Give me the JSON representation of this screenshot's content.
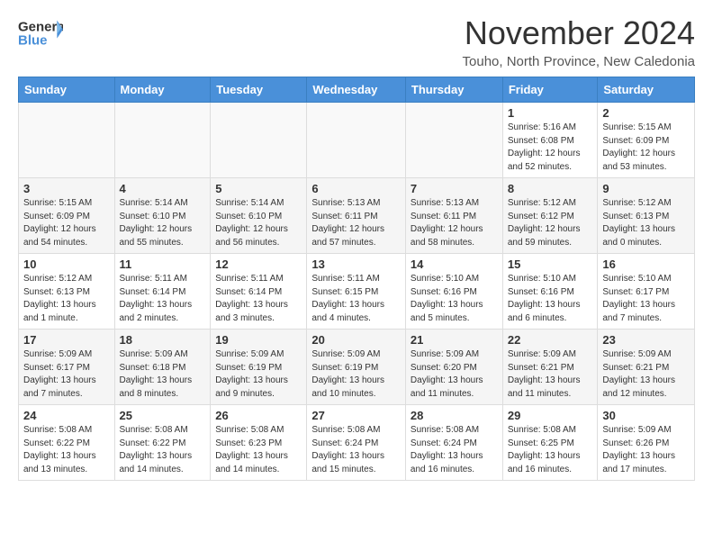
{
  "header": {
    "logo_general": "General",
    "logo_blue": "Blue",
    "month_title": "November 2024",
    "location": "Touho, North Province, New Caledonia"
  },
  "calendar": {
    "weekdays": [
      "Sunday",
      "Monday",
      "Tuesday",
      "Wednesday",
      "Thursday",
      "Friday",
      "Saturday"
    ],
    "weeks": [
      [
        {
          "day": "",
          "info": ""
        },
        {
          "day": "",
          "info": ""
        },
        {
          "day": "",
          "info": ""
        },
        {
          "day": "",
          "info": ""
        },
        {
          "day": "",
          "info": ""
        },
        {
          "day": "1",
          "info": "Sunrise: 5:16 AM\nSunset: 6:08 PM\nDaylight: 12 hours\nand 52 minutes."
        },
        {
          "day": "2",
          "info": "Sunrise: 5:15 AM\nSunset: 6:09 PM\nDaylight: 12 hours\nand 53 minutes."
        }
      ],
      [
        {
          "day": "3",
          "info": "Sunrise: 5:15 AM\nSunset: 6:09 PM\nDaylight: 12 hours\nand 54 minutes."
        },
        {
          "day": "4",
          "info": "Sunrise: 5:14 AM\nSunset: 6:10 PM\nDaylight: 12 hours\nand 55 minutes."
        },
        {
          "day": "5",
          "info": "Sunrise: 5:14 AM\nSunset: 6:10 PM\nDaylight: 12 hours\nand 56 minutes."
        },
        {
          "day": "6",
          "info": "Sunrise: 5:13 AM\nSunset: 6:11 PM\nDaylight: 12 hours\nand 57 minutes."
        },
        {
          "day": "7",
          "info": "Sunrise: 5:13 AM\nSunset: 6:11 PM\nDaylight: 12 hours\nand 58 minutes."
        },
        {
          "day": "8",
          "info": "Sunrise: 5:12 AM\nSunset: 6:12 PM\nDaylight: 12 hours\nand 59 minutes."
        },
        {
          "day": "9",
          "info": "Sunrise: 5:12 AM\nSunset: 6:13 PM\nDaylight: 13 hours\nand 0 minutes."
        }
      ],
      [
        {
          "day": "10",
          "info": "Sunrise: 5:12 AM\nSunset: 6:13 PM\nDaylight: 13 hours\nand 1 minute."
        },
        {
          "day": "11",
          "info": "Sunrise: 5:11 AM\nSunset: 6:14 PM\nDaylight: 13 hours\nand 2 minutes."
        },
        {
          "day": "12",
          "info": "Sunrise: 5:11 AM\nSunset: 6:14 PM\nDaylight: 13 hours\nand 3 minutes."
        },
        {
          "day": "13",
          "info": "Sunrise: 5:11 AM\nSunset: 6:15 PM\nDaylight: 13 hours\nand 4 minutes."
        },
        {
          "day": "14",
          "info": "Sunrise: 5:10 AM\nSunset: 6:16 PM\nDaylight: 13 hours\nand 5 minutes."
        },
        {
          "day": "15",
          "info": "Sunrise: 5:10 AM\nSunset: 6:16 PM\nDaylight: 13 hours\nand 6 minutes."
        },
        {
          "day": "16",
          "info": "Sunrise: 5:10 AM\nSunset: 6:17 PM\nDaylight: 13 hours\nand 7 minutes."
        }
      ],
      [
        {
          "day": "17",
          "info": "Sunrise: 5:09 AM\nSunset: 6:17 PM\nDaylight: 13 hours\nand 7 minutes."
        },
        {
          "day": "18",
          "info": "Sunrise: 5:09 AM\nSunset: 6:18 PM\nDaylight: 13 hours\nand 8 minutes."
        },
        {
          "day": "19",
          "info": "Sunrise: 5:09 AM\nSunset: 6:19 PM\nDaylight: 13 hours\nand 9 minutes."
        },
        {
          "day": "20",
          "info": "Sunrise: 5:09 AM\nSunset: 6:19 PM\nDaylight: 13 hours\nand 10 minutes."
        },
        {
          "day": "21",
          "info": "Sunrise: 5:09 AM\nSunset: 6:20 PM\nDaylight: 13 hours\nand 11 minutes."
        },
        {
          "day": "22",
          "info": "Sunrise: 5:09 AM\nSunset: 6:21 PM\nDaylight: 13 hours\nand 11 minutes."
        },
        {
          "day": "23",
          "info": "Sunrise: 5:09 AM\nSunset: 6:21 PM\nDaylight: 13 hours\nand 12 minutes."
        }
      ],
      [
        {
          "day": "24",
          "info": "Sunrise: 5:08 AM\nSunset: 6:22 PM\nDaylight: 13 hours\nand 13 minutes."
        },
        {
          "day": "25",
          "info": "Sunrise: 5:08 AM\nSunset: 6:22 PM\nDaylight: 13 hours\nand 14 minutes."
        },
        {
          "day": "26",
          "info": "Sunrise: 5:08 AM\nSunset: 6:23 PM\nDaylight: 13 hours\nand 14 minutes."
        },
        {
          "day": "27",
          "info": "Sunrise: 5:08 AM\nSunset: 6:24 PM\nDaylight: 13 hours\nand 15 minutes."
        },
        {
          "day": "28",
          "info": "Sunrise: 5:08 AM\nSunset: 6:24 PM\nDaylight: 13 hours\nand 16 minutes."
        },
        {
          "day": "29",
          "info": "Sunrise: 5:08 AM\nSunset: 6:25 PM\nDaylight: 13 hours\nand 16 minutes."
        },
        {
          "day": "30",
          "info": "Sunrise: 5:09 AM\nSunset: 6:26 PM\nDaylight: 13 hours\nand 17 minutes."
        }
      ]
    ]
  }
}
